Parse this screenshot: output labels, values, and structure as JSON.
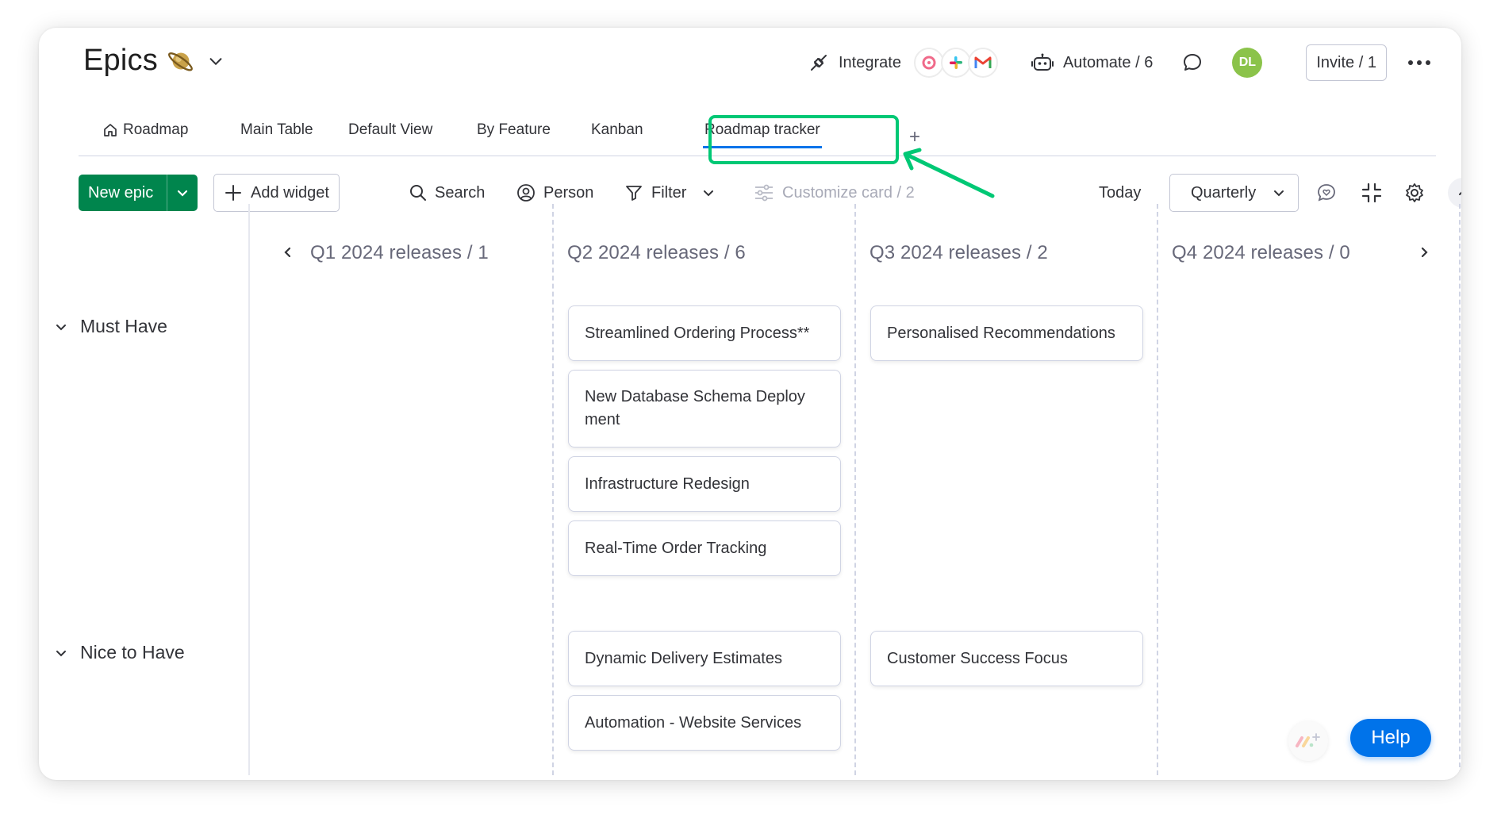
{
  "board": {
    "title": "Epics",
    "emoji_icon": "ringed-planet-icon"
  },
  "header": {
    "integrate_label": "Integrate",
    "integrations": [
      "pink-app-icon",
      "slack-icon",
      "gmail-icon"
    ],
    "automate_label": "Automate / 6",
    "avatar_initials": "DL",
    "avatar_color": "#8bc34a",
    "invite_label": "Invite / 1"
  },
  "tabs": [
    {
      "label": "Roadmap",
      "icon": "home-icon"
    },
    {
      "label": "Main Table"
    },
    {
      "label": "Default View"
    },
    {
      "label": "By Feature"
    },
    {
      "label": "Kanban"
    },
    {
      "label": "Roadmap tracker",
      "active": true
    }
  ],
  "tab_add_label": "+",
  "toolbar": {
    "new_epic_label": "New epic",
    "add_widget_label": "Add widget",
    "search_label": "Search",
    "person_label": "Person",
    "filter_label": "Filter",
    "customize_label": "Customize card / 2",
    "today_label": "Today",
    "period_label": "Quarterly"
  },
  "columns": [
    {
      "title": "Q1 2024 releases",
      "count": "/ 1"
    },
    {
      "title": "Q2 2024 releases",
      "count": "/ 6"
    },
    {
      "title": "Q3 2024 releases",
      "count": "/ 2"
    },
    {
      "title": "Q4 2024 releases",
      "count": "/ 0"
    }
  ],
  "lanes": [
    {
      "label": "Must Have",
      "q2": [
        "Streamlined Ordering Process**",
        "New Database Schema Deploy ment",
        "Infrastructure Redesign",
        "Real-Time Order Tracking"
      ],
      "q3": [
        "Personalised Recommendations"
      ]
    },
    {
      "label": "Nice to Have",
      "q2": [
        "Dynamic Delivery Estimates",
        "Automation - Website Services"
      ],
      "q3": [
        "Customer Success Focus"
      ]
    }
  ],
  "help_label": "Help",
  "colors": {
    "primary_green": "#00854d",
    "highlight_green": "#00c875",
    "help_blue": "#0073ea",
    "column_title": "#676879"
  }
}
